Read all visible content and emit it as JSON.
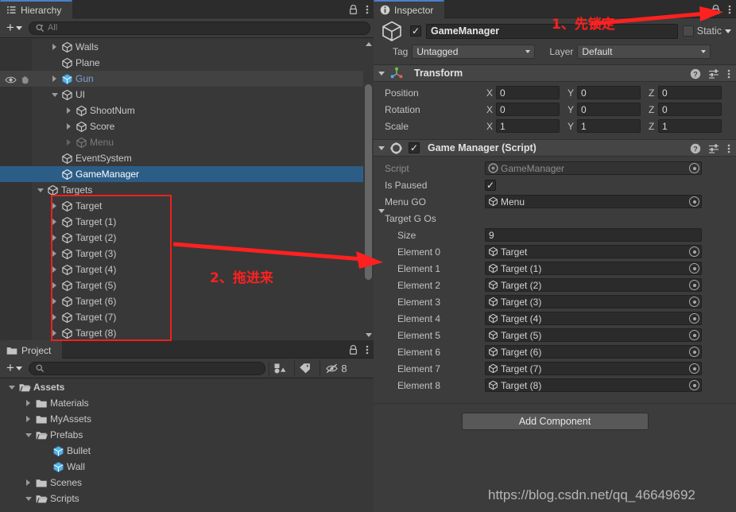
{
  "hierarchy": {
    "tab_label": "Hierarchy",
    "tab_icon": "hierarchy-icon",
    "lock_icon": "lock-icon",
    "menu_icon": "kebab-menu-icon",
    "create_label": "+",
    "search_placeholder": "All",
    "items": [
      {
        "label": "Walls",
        "depth": 2,
        "arrow": "right",
        "icon": "gameobject-icon",
        "state": "normal"
      },
      {
        "label": "Plane",
        "depth": 2,
        "arrow": "none",
        "icon": "gameobject-icon",
        "state": "normal"
      },
      {
        "label": "Gun",
        "depth": 2,
        "arrow": "right",
        "icon": "prefab-icon",
        "state": "prefab"
      },
      {
        "label": "UI",
        "depth": 2,
        "arrow": "down",
        "icon": "gameobject-icon",
        "state": "normal"
      },
      {
        "label": "ShootNum",
        "depth": 3,
        "arrow": "right",
        "icon": "gameobject-icon",
        "state": "normal"
      },
      {
        "label": "Score",
        "depth": 3,
        "arrow": "right",
        "icon": "gameobject-icon",
        "state": "normal"
      },
      {
        "label": "Menu",
        "depth": 3,
        "arrow": "right",
        "icon": "gameobject-icon",
        "state": "disabled"
      },
      {
        "label": "EventSystem",
        "depth": 2,
        "arrow": "none",
        "icon": "gameobject-icon",
        "state": "normal"
      },
      {
        "label": "GameManager",
        "depth": 2,
        "arrow": "none",
        "icon": "gameobject-icon",
        "state": "selected"
      },
      {
        "label": "Targets",
        "depth": 1,
        "arrow": "down",
        "icon": "gameobject-icon",
        "state": "normal"
      },
      {
        "label": "Target",
        "depth": 2,
        "arrow": "right",
        "icon": "gameobject-icon",
        "state": "normal"
      },
      {
        "label": "Target (1)",
        "depth": 2,
        "arrow": "right",
        "icon": "gameobject-icon",
        "state": "normal"
      },
      {
        "label": "Target (2)",
        "depth": 2,
        "arrow": "right",
        "icon": "gameobject-icon",
        "state": "normal"
      },
      {
        "label": "Target (3)",
        "depth": 2,
        "arrow": "right",
        "icon": "gameobject-icon",
        "state": "normal"
      },
      {
        "label": "Target (4)",
        "depth": 2,
        "arrow": "right",
        "icon": "gameobject-icon",
        "state": "normal"
      },
      {
        "label": "Target (5)",
        "depth": 2,
        "arrow": "right",
        "icon": "gameobject-icon",
        "state": "normal"
      },
      {
        "label": "Target (6)",
        "depth": 2,
        "arrow": "right",
        "icon": "gameobject-icon",
        "state": "normal"
      },
      {
        "label": "Target (7)",
        "depth": 2,
        "arrow": "right",
        "icon": "gameobject-icon",
        "state": "normal"
      },
      {
        "label": "Target (8)",
        "depth": 2,
        "arrow": "right",
        "icon": "gameobject-icon",
        "state": "normal"
      }
    ]
  },
  "project": {
    "tab_label": "Project",
    "tab_icon": "folder-icon",
    "lock_icon": "lock-icon",
    "menu_icon": "kebab-menu-icon",
    "create_label": "+",
    "search_placeholder": "",
    "filter_buttons": [
      {
        "name": "type-filter-icon",
        "label": ""
      },
      {
        "name": "label-filter-icon",
        "label": ""
      }
    ],
    "hidden_count": "8",
    "items": [
      {
        "label": "Assets",
        "depth": 0,
        "arrow": "down",
        "icon": "folder-open-icon",
        "bold": true
      },
      {
        "label": "Materials",
        "depth": 1,
        "arrow": "right",
        "icon": "folder-icon",
        "bold": false
      },
      {
        "label": "MyAssets",
        "depth": 1,
        "arrow": "right",
        "icon": "folder-icon",
        "bold": false
      },
      {
        "label": "Prefabs",
        "depth": 1,
        "arrow": "down",
        "icon": "folder-open-icon",
        "bold": false
      },
      {
        "label": "Bullet",
        "depth": 2,
        "arrow": "none",
        "icon": "prefab-icon",
        "bold": false
      },
      {
        "label": "Wall",
        "depth": 2,
        "arrow": "none",
        "icon": "prefab-icon",
        "bold": false
      },
      {
        "label": "Scenes",
        "depth": 1,
        "arrow": "right",
        "icon": "folder-icon",
        "bold": false
      },
      {
        "label": "Scripts",
        "depth": 1,
        "arrow": "down",
        "icon": "folder-open-icon",
        "bold": false
      }
    ]
  },
  "inspector": {
    "tab_label": "Inspector",
    "tab_icon": "info-icon",
    "lock_icon": "lock-icon",
    "menu_icon": "kebab-menu-icon",
    "object_icon": "gameobject-icon",
    "enabled": true,
    "name_value": "GameManager",
    "static_label": "Static",
    "static_checked": false,
    "tag_label": "Tag",
    "tag_value": "Untagged",
    "layer_label": "Layer",
    "layer_value": "Default",
    "help_icon": "help-icon",
    "preset_icon": "preset-icon",
    "components": [
      {
        "title": "Transform",
        "icon": "transform-icon",
        "has_enable_checkbox": false,
        "rows": [
          {
            "label": "Position",
            "axes": [
              "X",
              "Y",
              "Z"
            ],
            "values": [
              "0",
              "0",
              "0"
            ]
          },
          {
            "label": "Rotation",
            "axes": [
              "X",
              "Y",
              "Z"
            ],
            "values": [
              "0",
              "0",
              "0"
            ]
          },
          {
            "label": "Scale",
            "axes": [
              "X",
              "Y",
              "Z"
            ],
            "values": [
              "1",
              "1",
              "1"
            ]
          }
        ]
      },
      {
        "title": "Game Manager (Script)",
        "icon": "script-gear-icon",
        "has_enable_checkbox": true,
        "enabled": true,
        "fields": [
          {
            "type": "object-readonly",
            "label": "Script",
            "value": "GameManager",
            "icon": "script-icon"
          },
          {
            "type": "checkbox",
            "label": "Is Paused",
            "checked": true
          },
          {
            "type": "object",
            "label": "Menu GO",
            "value": "Menu",
            "icon": "gameobject-icon"
          },
          {
            "type": "foldout",
            "label": "Target G Os",
            "expanded": true
          },
          {
            "type": "size",
            "label": "Size",
            "value": "9"
          },
          {
            "type": "object",
            "label": "Element 0",
            "value": "Target",
            "icon": "gameobject-icon"
          },
          {
            "type": "object",
            "label": "Element 1",
            "value": "Target (1)",
            "icon": "gameobject-icon"
          },
          {
            "type": "object",
            "label": "Element 2",
            "value": "Target (2)",
            "icon": "gameobject-icon"
          },
          {
            "type": "object",
            "label": "Element 3",
            "value": "Target (3)",
            "icon": "gameobject-icon"
          },
          {
            "type": "object",
            "label": "Element 4",
            "value": "Target (4)",
            "icon": "gameobject-icon"
          },
          {
            "type": "object",
            "label": "Element 5",
            "value": "Target (5)",
            "icon": "gameobject-icon"
          },
          {
            "type": "object",
            "label": "Element 6",
            "value": "Target (6)",
            "icon": "gameobject-icon"
          },
          {
            "type": "object",
            "label": "Element 7",
            "value": "Target (7)",
            "icon": "gameobject-icon"
          },
          {
            "type": "object",
            "label": "Element 8",
            "value": "Target (8)",
            "icon": "gameobject-icon"
          }
        ]
      }
    ],
    "add_component_label": "Add Component"
  },
  "annotations": {
    "step1_text": "1、先锁定",
    "step2_text": "2、拖进来",
    "accent_color": "#ff2020"
  },
  "watermark": {
    "text": "https://blog.csdn.net/qq_46649692"
  }
}
